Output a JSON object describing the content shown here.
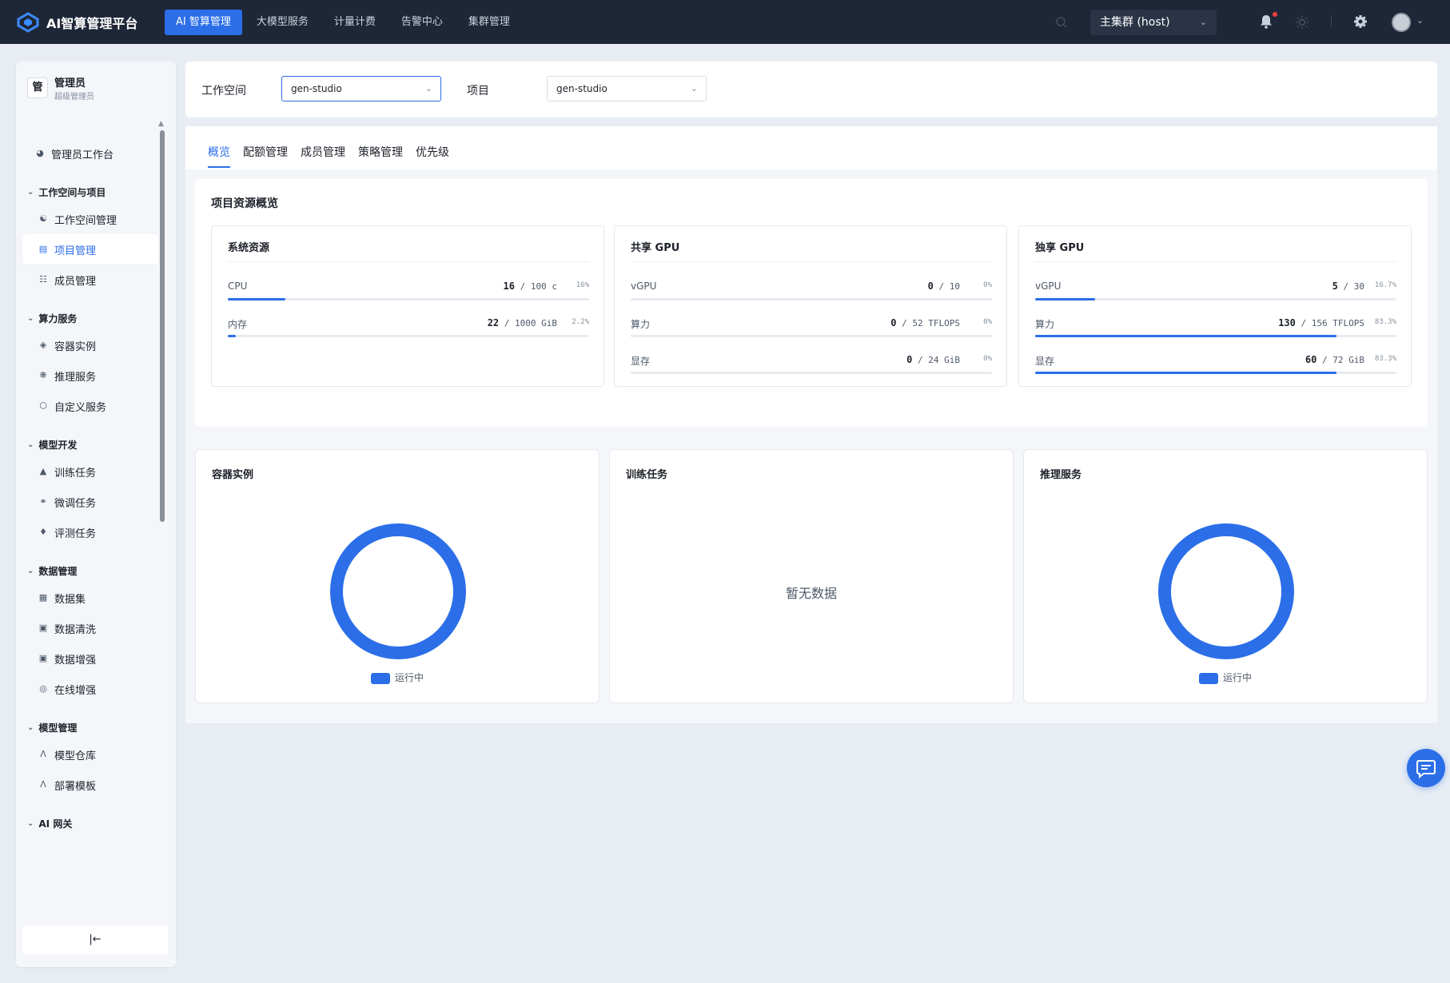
{
  "app": {
    "title": "AI智算管理平台"
  },
  "nav": {
    "items": [
      {
        "label": "AI 智算管理",
        "active": true
      },
      {
        "label": "大模型服务"
      },
      {
        "label": "计量计费"
      },
      {
        "label": "告警中心"
      },
      {
        "label": "集群管理"
      }
    ]
  },
  "header": {
    "cluster": "主集群 (host)"
  },
  "sidebar": {
    "user": {
      "badge": "管",
      "name": "管理员",
      "role": "超级管理员"
    },
    "workbench": "管理员工作台",
    "groups": [
      {
        "label": "工作空间与项目",
        "items": [
          "工作空间管理",
          "项目管理",
          "成员管理"
        ]
      },
      {
        "label": "算力服务",
        "items": [
          "容器实例",
          "推理服务",
          "自定义服务"
        ]
      },
      {
        "label": "模型开发",
        "items": [
          "训练任务",
          "微调任务",
          "评测任务"
        ]
      },
      {
        "label": "数据管理",
        "items": [
          "数据集",
          "数据清洗",
          "数据增强",
          "在线增强"
        ]
      },
      {
        "label": "模型管理",
        "items": [
          "模型仓库",
          "部署模板"
        ]
      },
      {
        "label": "AI 网关",
        "items": []
      }
    ],
    "active_item": "项目管理",
    "collapse": "|←"
  },
  "filters": {
    "workspace_label": "工作空间",
    "workspace_value": "gen-studio",
    "project_label": "项目",
    "project_value": "gen-studio"
  },
  "tabs": [
    "概览",
    "配额管理",
    "成员管理",
    "策略管理",
    "优先级"
  ],
  "overview": {
    "title": "项目资源概览",
    "cards": [
      {
        "title": "系统资源",
        "rows": [
          {
            "label": "CPU",
            "used": "16",
            "total": "100 c",
            "pct": "16%",
            "fraction": 0.16
          },
          {
            "label": "内存",
            "used": "22",
            "total": "1000 GiB",
            "pct": "2.2%",
            "fraction": 0.022
          }
        ]
      },
      {
        "title": "共享 GPU",
        "rows": [
          {
            "label": "vGPU",
            "used": "0",
            "total": "10",
            "pct": "0%",
            "fraction": 0
          },
          {
            "label": "算力",
            "used": "0",
            "total": "52 TFLOPS",
            "pct": "0%",
            "fraction": 0
          },
          {
            "label": "显存",
            "used": "0",
            "total": "24 GiB",
            "pct": "0%",
            "fraction": 0
          }
        ]
      },
      {
        "title": "独享 GPU",
        "rows": [
          {
            "label": "vGPU",
            "used": "5",
            "total": "30",
            "pct": "16.7%",
            "fraction": 0.167
          },
          {
            "label": "算力",
            "used": "130",
            "total": "156 TFLOPS",
            "pct": "83.3%",
            "fraction": 0.833
          },
          {
            "label": "显存",
            "used": "60",
            "total": "72 GiB",
            "pct": "83.3%",
            "fraction": 0.833
          }
        ]
      }
    ]
  },
  "stats": [
    {
      "title": "容器实例",
      "legend": "运行中",
      "has_data": true
    },
    {
      "title": "训练任务",
      "empty_text": "暂无数据",
      "has_data": false
    },
    {
      "title": "推理服务",
      "legend": "运行中",
      "has_data": true
    }
  ],
  "colors": {
    "accent": "#2b6ee8",
    "topbar": "#1e2737",
    "alert": "#f53f3f"
  },
  "icons": [
    "logo-icon",
    "search-icon",
    "bell-icon",
    "sun-icon",
    "gear-icon",
    "user-avatar-icon",
    "chat-icon"
  ]
}
